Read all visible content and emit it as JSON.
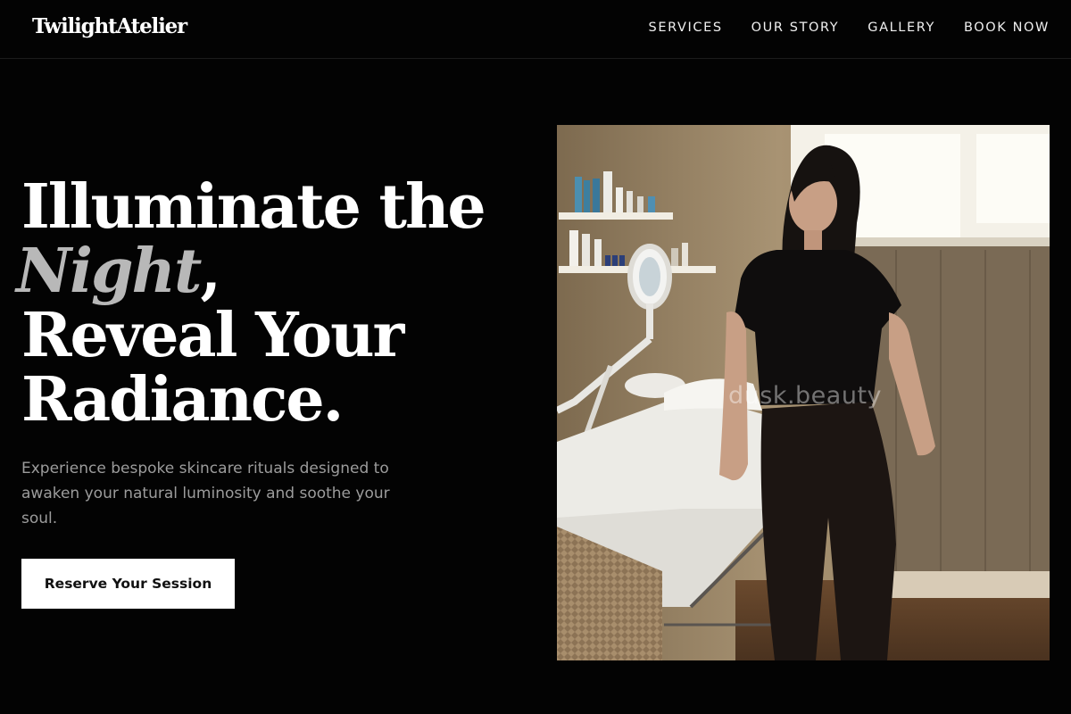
{
  "brand": {
    "logo_text": "TwilightAtelier"
  },
  "nav": {
    "items": [
      {
        "label": "SERVICES"
      },
      {
        "label": "OUR STORY"
      },
      {
        "label": "GALLERY"
      },
      {
        "label": "BOOK NOW"
      }
    ]
  },
  "hero": {
    "headline_line1": "Illuminate the",
    "headline_em": "Night",
    "headline_comma": ",",
    "headline_line3": "Reveal Your",
    "headline_line4": "Radiance.",
    "subtitle": "Experience bespoke skincare rituals designed to awaken your natural luminosity and soothe your soul.",
    "cta_label": "Reserve Your Session",
    "photo_watermark": "dusk.beauty"
  },
  "colors": {
    "background": "#030303",
    "text_primary": "#ffffff",
    "text_muted": "#9c9c9c",
    "headline_accent": "#b8b8b8",
    "cta_background": "#ffffff",
    "cta_text": "#111111"
  }
}
